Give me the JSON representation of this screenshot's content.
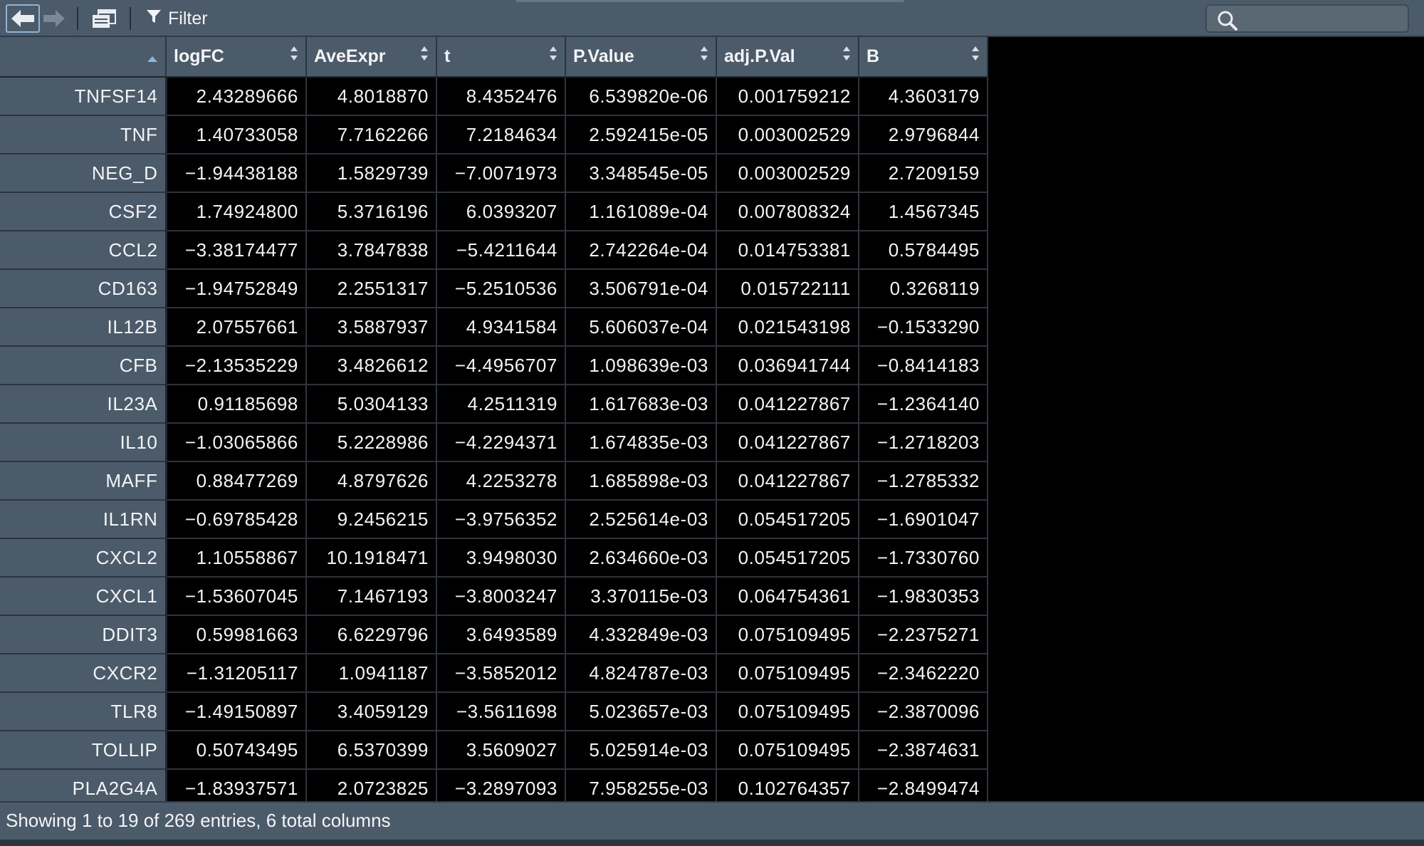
{
  "toolbar": {
    "filter_label": "Filter",
    "search": {
      "value": "",
      "placeholder": ""
    }
  },
  "table": {
    "columns": [
      {
        "key": "rowname",
        "label": "",
        "sort": "ascending"
      },
      {
        "key": "logFC",
        "label": "logFC"
      },
      {
        "key": "AveExpr",
        "label": "AveExpr"
      },
      {
        "key": "t",
        "label": "t"
      },
      {
        "key": "P.Value",
        "label": "P.Value"
      },
      {
        "key": "adj.P.Val",
        "label": "adj.P.Val"
      },
      {
        "key": "B",
        "label": "B"
      }
    ],
    "rows": [
      [
        "TNFSF14",
        "2.43289666",
        "4.8018870",
        "8.4352476",
        "6.539820e-06",
        "0.001759212",
        "4.3603179"
      ],
      [
        "TNF",
        "1.40733058",
        "7.7162266",
        "7.2184634",
        "2.592415e-05",
        "0.003002529",
        "2.9796844"
      ],
      [
        "NEG_D",
        "-1.94438188",
        "1.5829739",
        "-7.0071973",
        "3.348545e-05",
        "0.003002529",
        "2.7209159"
      ],
      [
        "CSF2",
        "1.74924800",
        "5.3716196",
        "6.0393207",
        "1.161089e-04",
        "0.007808324",
        "1.4567345"
      ],
      [
        "CCL2",
        "-3.38174477",
        "3.7847838",
        "-5.4211644",
        "2.742264e-04",
        "0.014753381",
        "0.5784495"
      ],
      [
        "CD163",
        "-1.94752849",
        "2.2551317",
        "-5.2510536",
        "3.506791e-04",
        "0.015722111",
        "0.3268119"
      ],
      [
        "IL12B",
        "2.07557661",
        "3.5887937",
        "4.9341584",
        "5.606037e-04",
        "0.021543198",
        "-0.1533290"
      ],
      [
        "CFB",
        "-2.13535229",
        "3.4826612",
        "-4.4956707",
        "1.098639e-03",
        "0.036941744",
        "-0.8414183"
      ],
      [
        "IL23A",
        "0.91185698",
        "5.0304133",
        "4.2511319",
        "1.617683e-03",
        "0.041227867",
        "-1.2364140"
      ],
      [
        "IL10",
        "-1.03065866",
        "5.2228986",
        "-4.2294371",
        "1.674835e-03",
        "0.041227867",
        "-1.2718203"
      ],
      [
        "MAFF",
        "0.88477269",
        "4.8797626",
        "4.2253278",
        "1.685898e-03",
        "0.041227867",
        "-1.2785332"
      ],
      [
        "IL1RN",
        "-0.69785428",
        "9.2456215",
        "-3.9756352",
        "2.525614e-03",
        "0.054517205",
        "-1.6901047"
      ],
      [
        "CXCL2",
        "1.10558867",
        "10.1918471",
        "3.9498030",
        "2.634660e-03",
        "0.054517205",
        "-1.7330760"
      ],
      [
        "CXCL1",
        "-1.53607045",
        "7.1467193",
        "-3.8003247",
        "3.370115e-03",
        "0.064754361",
        "-1.9830353"
      ],
      [
        "DDIT3",
        "0.59981663",
        "6.6229796",
        "3.6493589",
        "4.332849e-03",
        "0.075109495",
        "-2.2375271"
      ],
      [
        "CXCR2",
        "-1.31205117",
        "1.0941187",
        "-3.5852012",
        "4.824787e-03",
        "0.075109495",
        "-2.3462220"
      ],
      [
        "TLR8",
        "-1.49150897",
        "3.4059129",
        "-3.5611698",
        "5.023657e-03",
        "0.075109495",
        "-2.3870096"
      ],
      [
        "TOLLIP",
        "0.50743495",
        "6.5370399",
        "3.5609027",
        "5.025914e-03",
        "0.075109495",
        "-2.3874631"
      ],
      [
        "PLA2G4A",
        "-1.83937571",
        "2.0723825",
        "-3.2897093",
        "7.958255e-03",
        "0.102764357",
        "-2.8499474"
      ]
    ]
  },
  "footer": {
    "status": "Showing 1 to 19 of 269 entries, 6 total columns"
  },
  "colors": {
    "toolbar_bg": "#4c5b69",
    "cell_bg": "#000000",
    "text": "#f2f4f6",
    "grid_line": "#2a3540",
    "accent_border": "#8fb4da"
  },
  "icons": {
    "back": "back-arrow-icon",
    "forward": "forward-arrow-icon",
    "popout": "popout-window-icon",
    "filter": "filter-funnel-icon",
    "search": "search-icon",
    "sort": "sort-arrows-icon"
  }
}
